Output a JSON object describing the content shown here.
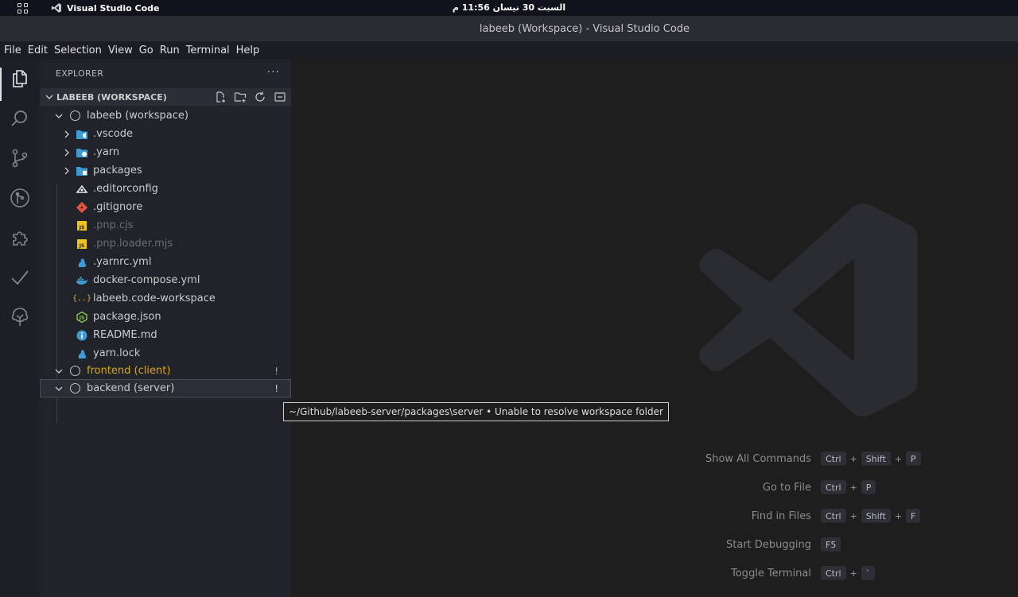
{
  "os_bar": {
    "app_name": "Visual Studio Code",
    "clock": "السبت 30 نيسان 11:56 م"
  },
  "window": {
    "title": "labeeb (Workspace) - Visual Studio Code"
  },
  "menu": [
    "File",
    "Edit",
    "Selection",
    "View",
    "Go",
    "Run",
    "Terminal",
    "Help"
  ],
  "activity_bar": [
    "files-icon",
    "search-icon",
    "source-control-icon",
    "git-graph-icon",
    "extensions-icon",
    "testing-icon",
    "tree-icon"
  ],
  "sidebar": {
    "title": "EXPLORER",
    "more": "···",
    "section": "LABEEB (WORKSPACE)",
    "section_tools": [
      "new-file-icon",
      "new-folder-icon",
      "refresh-icon",
      "collapse-all-icon"
    ],
    "roots": [
      {
        "label": "labeeb (workspace)",
        "expanded": true,
        "children": [
          {
            "label": ".vscode",
            "type": "folder",
            "icon": "vscode-folder-icon",
            "color": "#3f9bd6"
          },
          {
            "label": ".yarn",
            "type": "folder",
            "icon": "yarn-folder-icon",
            "color": "#3f9bd6"
          },
          {
            "label": "packages",
            "type": "folder",
            "icon": "packages-folder-icon",
            "color": "#3f9bd6"
          },
          {
            "label": ".editorconfig",
            "type": "file",
            "icon": "editorconfig-icon",
            "color": "#e8e8e8"
          },
          {
            "label": ".gitignore",
            "type": "file",
            "icon": "git-icon",
            "color": "#e0533c"
          },
          {
            "label": ".pnp.cjs",
            "type": "file",
            "icon": "js-icon",
            "color": "#f0c419",
            "dimmed": true
          },
          {
            "label": ".pnp.loader.mjs",
            "type": "file",
            "icon": "js-icon",
            "color": "#f0c419",
            "dimmed": true
          },
          {
            "label": ".yarnrc.yml",
            "type": "file",
            "icon": "yarn-icon",
            "color": "#3f9bd6"
          },
          {
            "label": "docker-compose.yml",
            "type": "file",
            "icon": "docker-icon",
            "color": "#3f9bd6"
          },
          {
            "label": "labeeb.code-workspace",
            "type": "file",
            "icon": "braces-icon",
            "color": "#e8a33b"
          },
          {
            "label": "package.json",
            "type": "file",
            "icon": "nodejs-icon",
            "color": "#8cc84b"
          },
          {
            "label": "README.md",
            "type": "file",
            "icon": "info-icon",
            "color": "#3f9bd6"
          },
          {
            "label": "yarn.lock",
            "type": "file",
            "icon": "yarn-icon",
            "color": "#3f9bd6"
          }
        ]
      },
      {
        "label": "frontend (client)",
        "expanded": true,
        "warning": "!",
        "color": "#d9a71b"
      },
      {
        "label": "backend (server)",
        "expanded": true,
        "warning": "!",
        "color": "#cccccc"
      }
    ]
  },
  "tooltip": "~/Github/labeeb-server/packages\\server • Unable to resolve workspace folder",
  "shortcuts": [
    {
      "label": "Show All Commands",
      "keys": [
        "Ctrl",
        "Shift",
        "P"
      ]
    },
    {
      "label": "Go to File",
      "keys": [
        "Ctrl",
        "P"
      ]
    },
    {
      "label": "Find in Files",
      "keys": [
        "Ctrl",
        "Shift",
        "F"
      ]
    },
    {
      "label": "Start Debugging",
      "keys": [
        "F5"
      ]
    },
    {
      "label": "Toggle Terminal",
      "keys": [
        "Ctrl",
        "`"
      ]
    }
  ]
}
